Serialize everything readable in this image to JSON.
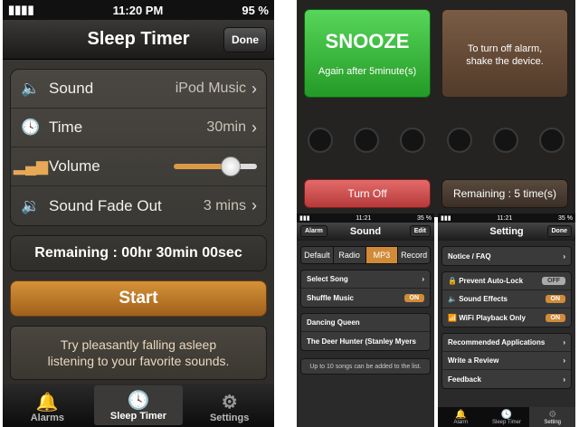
{
  "left": {
    "status": {
      "signal": "▮▮▮▮",
      "time": "11:20 PM",
      "battery": "95 %"
    },
    "nav": {
      "title": "Sleep Timer",
      "done": "Done"
    },
    "rows": [
      {
        "label": "Sound",
        "value": "iPod Music"
      },
      {
        "label": "Time",
        "value": "30min"
      },
      {
        "label": "Volume",
        "level": 0.62
      },
      {
        "label": "Sound Fade Out",
        "value": "3 mins"
      }
    ],
    "remaining": "Remaining : 00hr 30min 00sec",
    "start": "Start",
    "tip_line1": "Try pleasantly falling asleep",
    "tip_line2": "listening to your favorite sounds.",
    "tabs": [
      "Alarms",
      "Sleep Timer",
      "Settings"
    ]
  },
  "right_top": {
    "snooze": "SNOOZE",
    "snooze_sub": "Again after 5minute(s)",
    "shake_line1": "To turn off alarm,",
    "shake_line2": "shake the device.",
    "turn_off": "Turn Off",
    "remaining": "Remaining : 5 time(s)"
  },
  "sound_screen": {
    "status_time": "11:21",
    "status_batt": "35 %",
    "title": "Sound",
    "left_btn": "Alarm",
    "right_btn": "Edit",
    "segments": [
      "Default",
      "Radio",
      "MP3",
      "Record"
    ],
    "select_song": "Select Song",
    "shuffle": "Shuffle Music",
    "shuffle_state": "ON",
    "songs": [
      "Dancing Queen",
      "The Deer Hunter (Stanley Myers"
    ],
    "note": "Up to 10 songs can be added to the list."
  },
  "setting_screen": {
    "status_time": "11:21",
    "status_batt": "35 %",
    "title": "Setting",
    "right_btn": "Done",
    "notice": "Notice / FAQ",
    "toggles": [
      {
        "label": "Prevent Auto-Lock",
        "state": "OFF"
      },
      {
        "label": "Sound Effects",
        "state": "ON"
      },
      {
        "label": "WiFi Playback Only",
        "state": "ON"
      }
    ],
    "links": [
      "Recommended Applications",
      "Write a Review",
      "Feedback"
    ],
    "tabs": [
      "Alarm",
      "Sleep Timer",
      "Setting"
    ]
  }
}
